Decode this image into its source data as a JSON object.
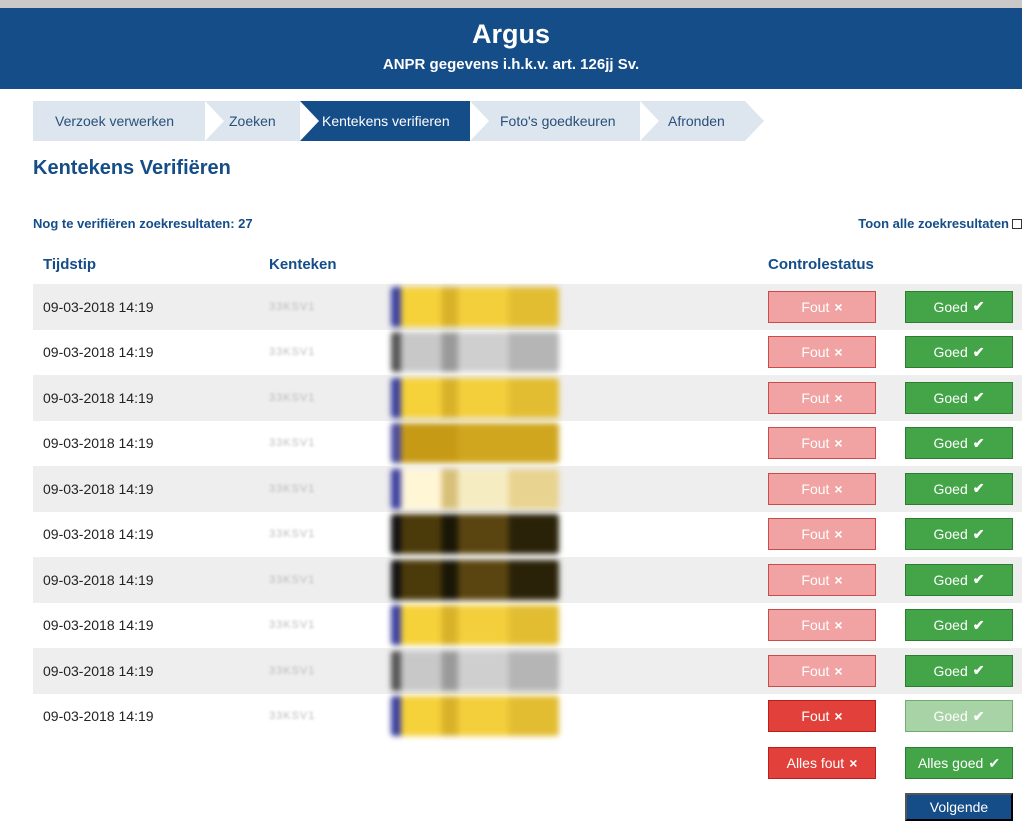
{
  "app": {
    "title": "Argus",
    "subtitle": "ANPR gegevens i.h.k.v. art. 126jj Sv."
  },
  "steps": [
    {
      "label": "Verzoek verwerken",
      "active": false
    },
    {
      "label": "Zoeken",
      "active": false
    },
    {
      "label": "Kentekens verifieren",
      "active": true
    },
    {
      "label": "Foto's goedkeuren",
      "active": false
    },
    {
      "label": "Afronden",
      "active": false
    }
  ],
  "page": {
    "title": "Kentekens Verifiëren",
    "remaining": "Nog te verifiëren zoekresultaten: 27",
    "show_all_label": "Toon alle zoekresultaten"
  },
  "columns": {
    "time": "Tijdstip",
    "plate": "Kenteken",
    "status": "Controlestatus"
  },
  "rows": [
    {
      "time": "09-03-2018 14:19",
      "plate": "33KSV1",
      "state": "none",
      "plate_color": "yellow"
    },
    {
      "time": "09-03-2018 14:19",
      "plate": "33KSV1",
      "state": "none",
      "plate_color": "gray"
    },
    {
      "time": "09-03-2018 14:19",
      "plate": "33KSV1",
      "state": "none",
      "plate_color": "yellow"
    },
    {
      "time": "09-03-2018 14:19",
      "plate": "33KSV1",
      "state": "none",
      "plate_color": "dark-yellow"
    },
    {
      "time": "09-03-2018 14:19",
      "plate": "33KSV1",
      "state": "none",
      "plate_color": "pale-yellow"
    },
    {
      "time": "09-03-2018 14:19",
      "plate": "33KSV1",
      "state": "none",
      "plate_color": "black"
    },
    {
      "time": "09-03-2018 14:19",
      "plate": "33KSV1",
      "state": "none",
      "plate_color": "black"
    },
    {
      "time": "09-03-2018 14:19",
      "plate": "33KSV1",
      "state": "none",
      "plate_color": "yellow"
    },
    {
      "time": "09-03-2018 14:19",
      "plate": "33KSV1",
      "state": "none",
      "plate_color": "gray"
    },
    {
      "time": "09-03-2018 14:19",
      "plate": "33KSV1",
      "state": "fout",
      "plate_color": "yellow"
    }
  ],
  "buttons": {
    "fout": "Fout",
    "goed": "Goed",
    "all_fout": "Alles fout",
    "all_goed": "Alles goed",
    "next": "Volgende"
  },
  "icons": {
    "cross": "×",
    "check": "✔"
  },
  "colors": {
    "brand": "#154d88",
    "fout": "#f1a2a2",
    "fout_selected": "#e2413b",
    "goed": "#43a548"
  }
}
